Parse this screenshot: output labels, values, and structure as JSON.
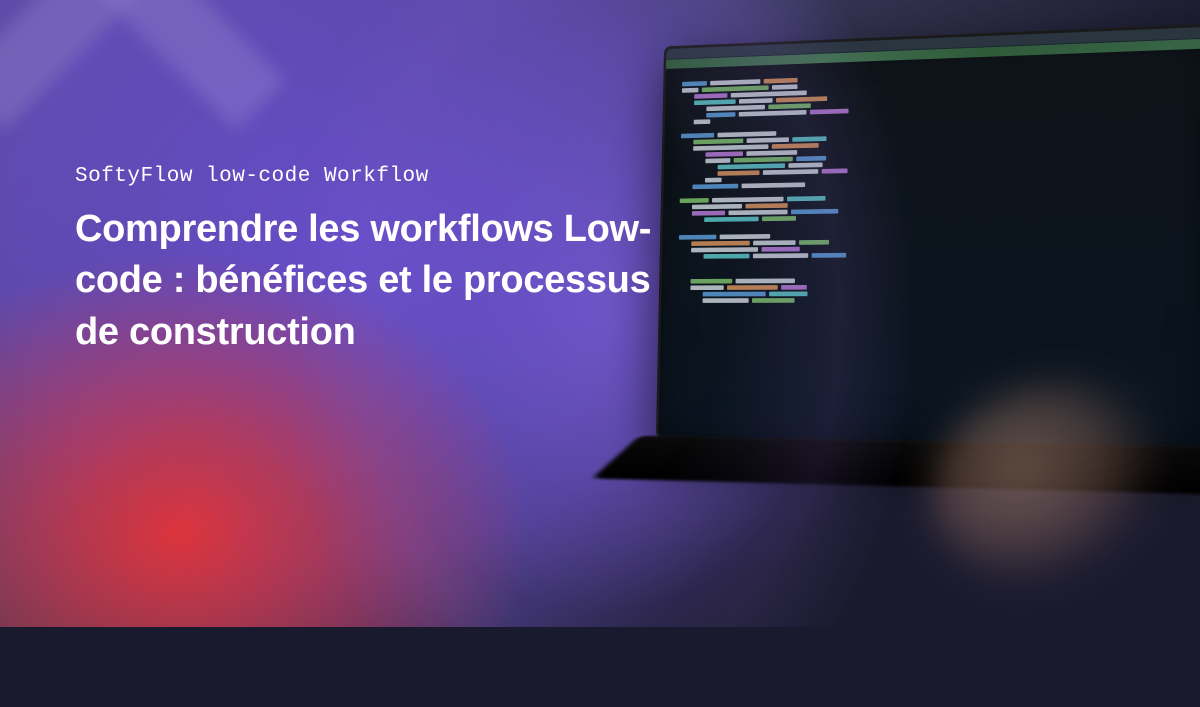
{
  "eyebrow": "SoftyFlow low-code Workflow",
  "headline": "Comprendre les workflows Low-code : bénéfices et le processus de construction"
}
